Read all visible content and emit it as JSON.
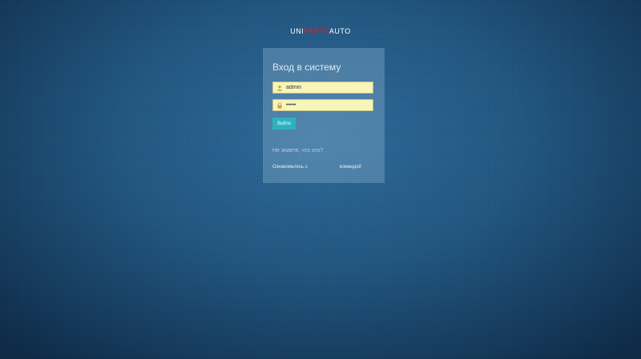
{
  "logo": {
    "part1": "UNI",
    "part2": "PARTS",
    "part3": "AUTO"
  },
  "login": {
    "title": "Вход в систему",
    "username_value": "admin",
    "password_value": "•••••",
    "submit_label": "Войти"
  },
  "help": {
    "question": "Не знаете, что это?",
    "text_before": "Ознакомьтесь с",
    "link_text": "командой"
  },
  "icons": {
    "username": "user-icon",
    "password": "lock-icon"
  },
  "colors": {
    "button": "#2bb3c0",
    "input_bg": "#f7f5b8",
    "logo_accent": "#e0202a"
  }
}
